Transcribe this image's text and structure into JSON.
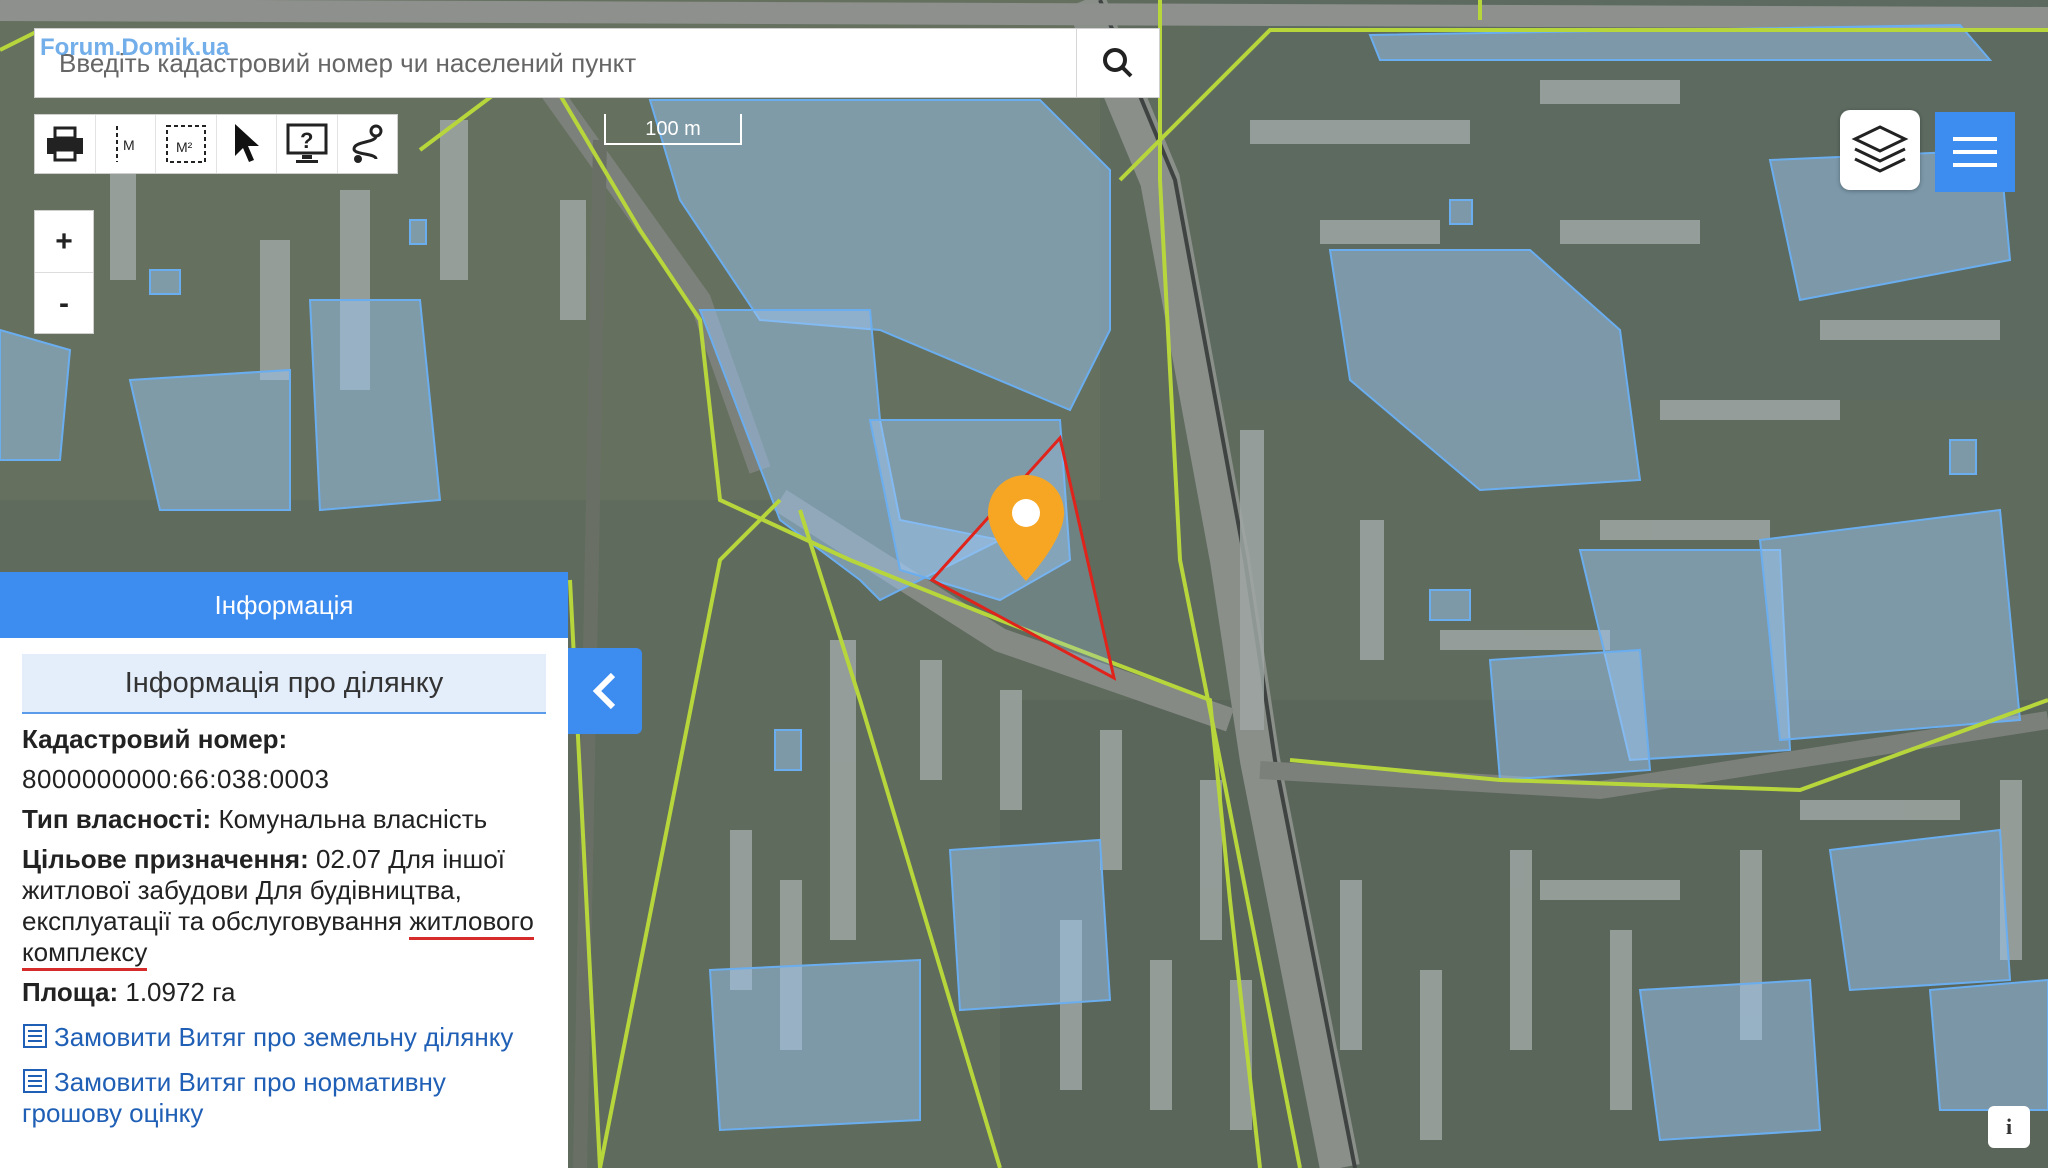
{
  "watermark": "Forum.Domik.ua",
  "search": {
    "placeholder": "Введіть кадастровий номер чи населений пункт",
    "button_icon": "search-icon"
  },
  "toolbar": {
    "items": [
      "printer-icon",
      "measure-distance-icon",
      "measure-area-icon",
      "pointer-icon",
      "identify-icon",
      "route-icon"
    ],
    "measure_distance_unit": "М",
    "measure_area_unit": "М²"
  },
  "zoom": {
    "in_label": "+",
    "out_label": "-"
  },
  "scale_bar": {
    "label": "100 m"
  },
  "controls": {
    "layers_icon": "layers-icon",
    "menu_icon": "hamburger-menu-icon",
    "info_label": "i"
  },
  "panel": {
    "header": "Інформація",
    "subheader": "Інформація про ділянку",
    "cadastral_label": "Кадастровий номер:",
    "cadastral_value": "8000000000:66:038:0003",
    "ownership_label": "Тип власності:",
    "ownership_value": "Комунальна власність",
    "purpose_label": "Цільове призначення:",
    "purpose_value_main": "02.07 Для іншої житлової забудови Для будівництва, експлуатації та обслуговування",
    "purpose_value_underlined": "житлового комплексу",
    "area_label": "Площа:",
    "area_value": "1.0972 га",
    "link1": "Замовити Витяг про земельну ділянку",
    "link2": "Замовити Витяг про нормативну грошову оцінку"
  },
  "colors": {
    "accent": "#3d8cf0",
    "parcel_fill": "#9cc6f2",
    "parcel_stroke": "#6aaef0",
    "boundary": "#b7d63c",
    "selected_outline": "#e0231b",
    "marker": "#f6a623"
  }
}
